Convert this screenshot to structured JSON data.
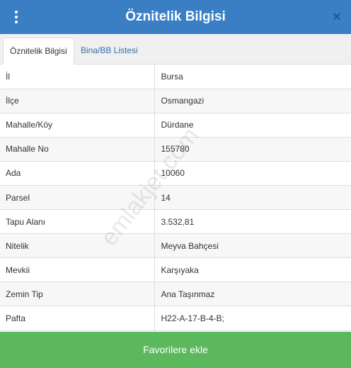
{
  "header": {
    "title": "Öznitelik Bilgisi",
    "close_glyph": "×"
  },
  "tabs": [
    {
      "label": "Öznitelik Bilgisi",
      "active": true
    },
    {
      "label": "Bina/BB Listesi",
      "active": false
    }
  ],
  "attributes": [
    {
      "key": "İl",
      "value": "Bursa"
    },
    {
      "key": "İlçe",
      "value": "Osmangazi"
    },
    {
      "key": "Mahalle/Köy",
      "value": "Dürdane"
    },
    {
      "key": "Mahalle No",
      "value": "155780"
    },
    {
      "key": "Ada",
      "value": "10060"
    },
    {
      "key": "Parsel",
      "value": "14"
    },
    {
      "key": "Tapu Alanı",
      "value": "3.532,81"
    },
    {
      "key": "Nitelik",
      "value": "Meyva Bahçesi"
    },
    {
      "key": "Mevkii",
      "value": "Karşıyaka"
    },
    {
      "key": "Zemin Tip",
      "value": "Ana Taşınmaz"
    },
    {
      "key": "Pafta",
      "value": "H22-A-17-B-4-B;"
    }
  ],
  "watermark": "emlakjet.com",
  "favorite_button": "Favorilere ekle",
  "colors": {
    "header": "#3a7fc4",
    "button": "#5cb85c",
    "tab_link": "#2f6fae"
  }
}
